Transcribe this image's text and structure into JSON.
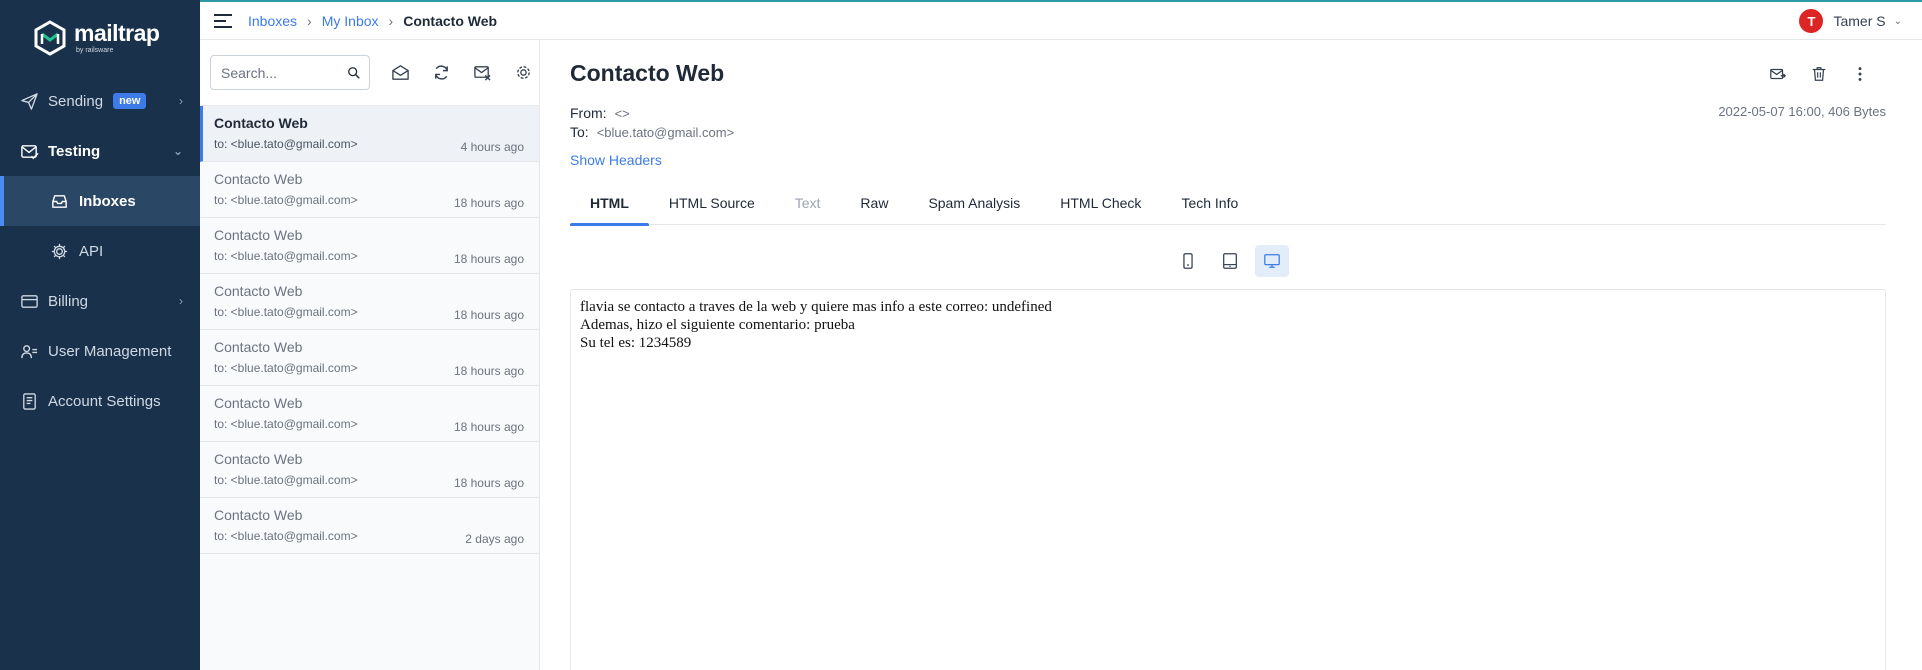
{
  "sidebar": {
    "logo_name": "mailtrap",
    "logo_sub": "by railsware",
    "items": [
      {
        "label": "Sending",
        "badge": "new"
      },
      {
        "label": "Testing"
      },
      {
        "label": "Inboxes"
      },
      {
        "label": "API"
      },
      {
        "label": "Billing"
      },
      {
        "label": "User Management"
      },
      {
        "label": "Account Settings"
      }
    ]
  },
  "topbar": {
    "breadcrumb": [
      "Inboxes",
      "My Inbox",
      "Contacto Web"
    ],
    "separator": "›",
    "user_initial": "T",
    "user_name": "Tamer S"
  },
  "list": {
    "search_placeholder": "Search...",
    "messages": [
      {
        "subject": "Contacto Web",
        "to": "to: <blue.tato@gmail.com>",
        "time": "4 hours ago",
        "selected": true
      },
      {
        "subject": "Contacto Web",
        "to": "to: <blue.tato@gmail.com>",
        "time": "18 hours ago"
      },
      {
        "subject": "Contacto Web",
        "to": "to: <blue.tato@gmail.com>",
        "time": "18 hours ago"
      },
      {
        "subject": "Contacto Web",
        "to": "to: <blue.tato@gmail.com>",
        "time": "18 hours ago"
      },
      {
        "subject": "Contacto Web",
        "to": "to: <blue.tato@gmail.com>",
        "time": "18 hours ago"
      },
      {
        "subject": "Contacto Web",
        "to": "to: <blue.tato@gmail.com>",
        "time": "18 hours ago"
      },
      {
        "subject": "Contacto Web",
        "to": "to: <blue.tato@gmail.com>",
        "time": "18 hours ago"
      },
      {
        "subject": "Contacto Web",
        "to": "to: <blue.tato@gmail.com>",
        "time": "2 days ago"
      }
    ]
  },
  "message": {
    "subject": "Contacto Web",
    "from_label": "From:",
    "from_value": "<>",
    "to_label": "To:",
    "to_value": "<blue.tato@gmail.com>",
    "date_size": "2022-05-07 16:00, 406 Bytes",
    "show_headers": "Show Headers",
    "tabs": [
      "HTML",
      "HTML Source",
      "Text",
      "Raw",
      "Spam Analysis",
      "HTML Check",
      "Tech Info"
    ],
    "active_tab": "HTML",
    "body_lines": [
      "flavia se contacto a traves de la web y quiere mas info a este correo: undefined",
      "Ademas, hizo el siguiente comentario: prueba",
      "Su tel es: 1234589"
    ]
  },
  "colors": {
    "sidebar_bg": "#19314b",
    "accent": "#3d7be8",
    "brand_green": "#22c38e",
    "avatar": "#dc2626"
  }
}
